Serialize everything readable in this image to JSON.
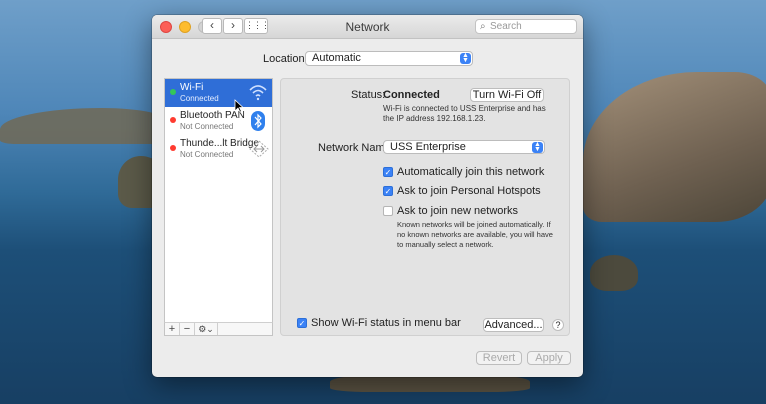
{
  "window": {
    "title": "Network",
    "search_placeholder": "Search",
    "nav": {
      "back": "‹",
      "forward": "›",
      "grid": "⋮⋮⋮"
    }
  },
  "location": {
    "label": "Location:",
    "value": "Automatic"
  },
  "services": [
    {
      "name": "Wi-Fi",
      "status": "Connected",
      "indicator": "#34c759",
      "icon": "wifi-icon",
      "selected": true
    },
    {
      "name": "Bluetooth PAN",
      "status": "Not Connected",
      "indicator": "#ff3b30",
      "icon": "bluetooth-icon",
      "selected": false
    },
    {
      "name": "Thunde...lt Bridge",
      "status": "Not Connected",
      "indicator": "#ff3b30",
      "icon": "thunderbolt-bridge-icon",
      "selected": false
    }
  ],
  "sidebar_controls": {
    "add": "+",
    "remove": "−",
    "action": "⚙︎⌄"
  },
  "detail": {
    "status_label": "Status:",
    "status_value": "Connected",
    "turn_off_button": "Turn Wi-Fi Off",
    "status_description": "Wi-Fi is connected to USS Enterprise and has the IP address 192.168.1.23.",
    "network_name_label": "Network Name:",
    "network_name_value": "USS Enterprise",
    "options": [
      {
        "label": "Automatically join this network",
        "checked": true
      },
      {
        "label": "Ask to join Personal Hotspots",
        "checked": true
      },
      {
        "label": "Ask to join new networks",
        "checked": false
      }
    ],
    "join_note": "Known networks will be joined automatically. If no known networks are available, you will have to manually select a network."
  },
  "footer": {
    "show_status_label": "Show Wi-Fi status in menu bar",
    "show_status_checked": true,
    "advanced_button": "Advanced...",
    "help_button": "?",
    "revert_button": "Revert",
    "apply_button": "Apply"
  },
  "colors": {
    "accent": "#3b82f6",
    "selection": "#2f6ed7",
    "connected": "#34c759",
    "disconnected": "#ff3b30"
  }
}
